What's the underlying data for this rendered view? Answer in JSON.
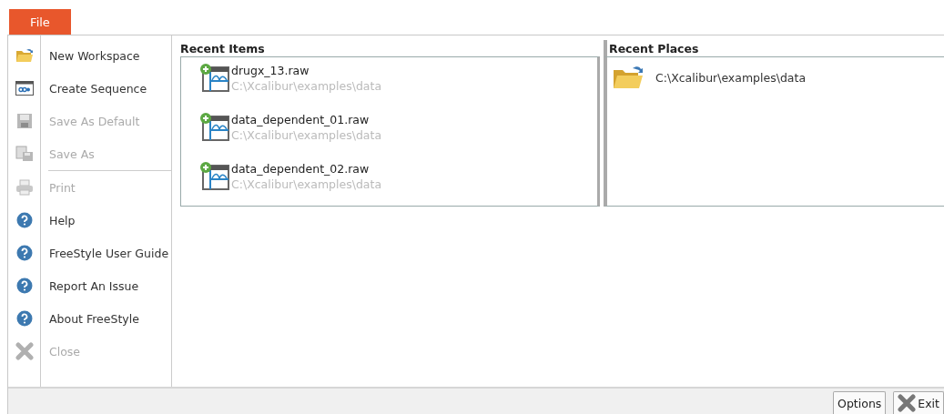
{
  "file_tab": {
    "label": "File",
    "selected": true
  },
  "menu": [
    {
      "kind": "folder",
      "label": "New Workspace",
      "disabled": false
    },
    {
      "kind": "sequence",
      "label": "Create Sequence",
      "disabled": false
    },
    {
      "kind": "floppy",
      "label": "Save As Default",
      "disabled": true
    },
    {
      "kind": "save-as",
      "label": "Save As",
      "disabled": true
    },
    {
      "kind": "separator"
    },
    {
      "kind": "printer",
      "label": "Print",
      "disabled": true
    },
    {
      "kind": "help",
      "label": "Help",
      "disabled": false
    },
    {
      "kind": "help",
      "label": "FreeStyle User Guide",
      "disabled": false
    },
    {
      "kind": "help",
      "label": "Report An Issue",
      "disabled": false
    },
    {
      "kind": "help",
      "label": "About FreeStyle",
      "disabled": false
    },
    {
      "kind": "close",
      "label": "Close",
      "disabled": true
    }
  ],
  "recent_items": {
    "title": "Recent Items",
    "items": [
      {
        "name": "drugx_13.raw",
        "path": "C:\\Xcalibur\\examples\\data"
      },
      {
        "name": "data_dependent_01.raw",
        "path": "C:\\Xcalibur\\examples\\data"
      },
      {
        "name": "data_dependent_02.raw",
        "path": "C:\\Xcalibur\\examples\\data"
      }
    ]
  },
  "recent_places": {
    "title": "Recent Places",
    "items": [
      {
        "path": "C:\\Xcalibur\\examples\\data"
      }
    ]
  },
  "buttons": [
    "Options",
    "Exit"
  ]
}
